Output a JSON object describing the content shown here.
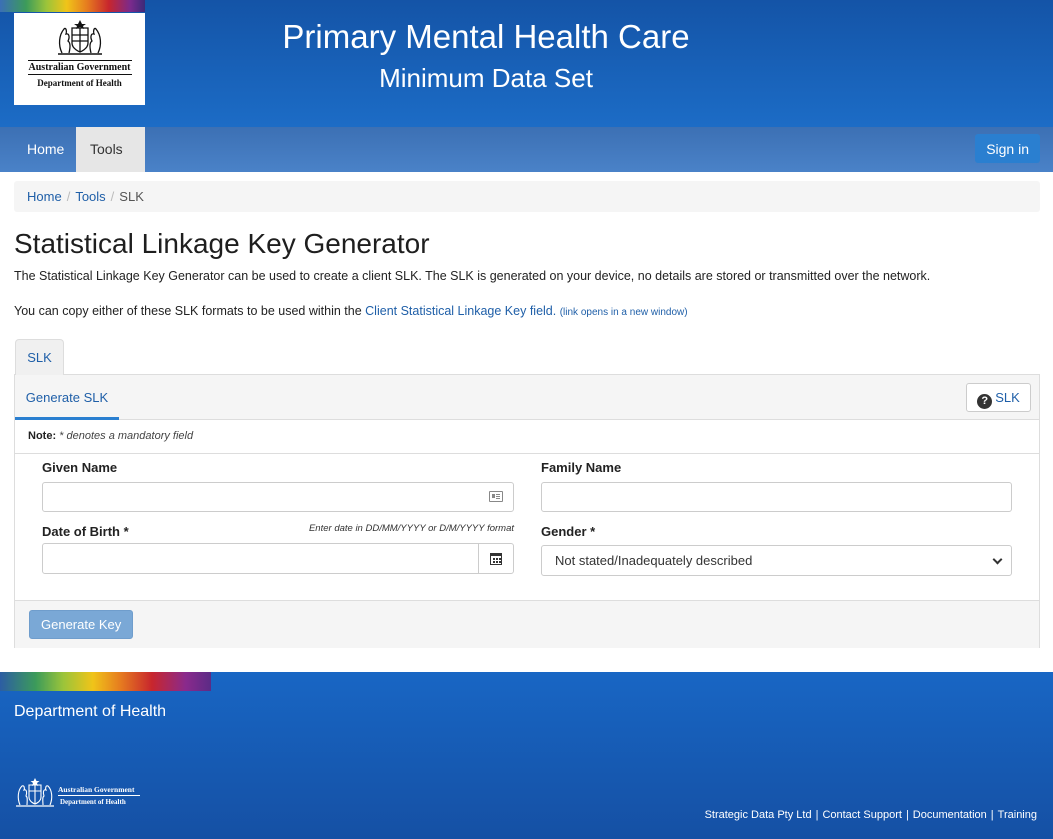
{
  "header": {
    "title_line1": "Primary Mental Health Care",
    "title_line2": "Minimum Data Set",
    "logo_line1": "Australian Government",
    "logo_line2": "Department of Health"
  },
  "navbar": {
    "home": "Home",
    "tools": "Tools",
    "signin": "Sign in"
  },
  "breadcrumb": {
    "home": "Home",
    "tools": "Tools",
    "current": "SLK",
    "separator": "/"
  },
  "main": {
    "title": "Statistical Linkage Key Generator",
    "intro": "The Statistical Linkage Key Generator can be used to create a client SLK. The SLK is generated on your device, no details are stored or transmitted over the network.",
    "copy_prefix": "You can copy either of these SLK formats to be used within the ",
    "copy_link": "Client Statistical Linkage Key field.",
    "copy_link_note": "(link opens in a new window)",
    "outer_tab": "SLK",
    "inner_tab": "Generate SLK",
    "help_button": "SLK",
    "note_label": "Note:",
    "note_text": "* denotes a mandatory field",
    "form": {
      "given_name_label": "Given Name",
      "given_name_value": "",
      "family_name_label": "Family Name",
      "family_name_value": "",
      "dob_label": "Date of Birth *",
      "dob_hint": "Enter date in DD/MM/YYYY or D/M/YYYY format",
      "dob_value": "",
      "gender_label": "Gender *",
      "gender_selected": "Not stated/Inadequately described"
    },
    "generate_button": "Generate Key"
  },
  "footer": {
    "department": "Department of Health",
    "logo_line1": "Australian Government",
    "logo_line2": "Department of Health",
    "company": "Strategic Data Pty Ltd",
    "contact": "Contact Support",
    "documentation": "Documentation",
    "training": "Training",
    "separator": "|"
  },
  "colors": {
    "header_blue": "#1454a7",
    "navbar_blue": "#3b74bb",
    "link_blue": "#1f5fa8",
    "accent_blue": "#2a7fd0"
  },
  "icons": {
    "crest": "coat-of-arms-icon",
    "help": "question-circle-icon",
    "contact_card": "contact-card-icon",
    "calendar": "calendar-icon",
    "caret": "caret-down-icon",
    "chevron": "chevron-down-icon"
  }
}
